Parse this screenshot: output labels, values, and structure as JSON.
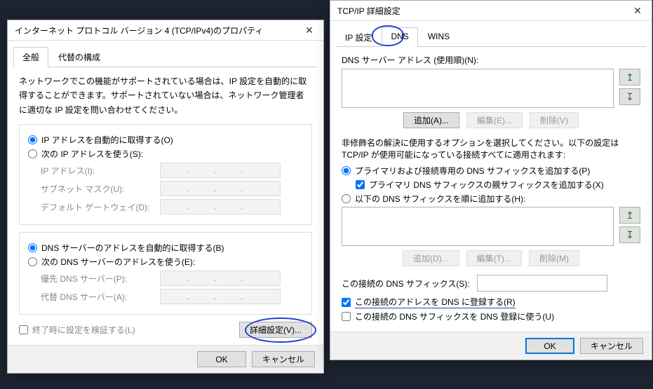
{
  "ipv4": {
    "title": "インターネット プロトコル バージョン 4 (TCP/IPv4)のプロパティ",
    "tabs": {
      "general": "全般",
      "alt": "代替の構成"
    },
    "description": "ネットワークでこの機能がサポートされている場合は、IP 設定を自動的に取得することができます。サポートされていない場合は、ネットワーク管理者に適切な IP 設定を問い合わせてください。",
    "ip_auto": "IP アドレスを自動的に取得する(O)",
    "ip_manual": "次の IP アドレスを使う(S):",
    "ip_label": "IP アドレス(I):",
    "mask_label": "サブネット マスク(U):",
    "gw_label": "デフォルト ゲートウェイ(D):",
    "dns_auto": "DNS サーバーのアドレスを自動的に取得する(B)",
    "dns_manual": "次の DNS サーバーのアドレスを使う(E):",
    "dns_pref": "優先 DNS サーバー(P):",
    "dns_alt": "代替 DNS サーバー(A):",
    "validate": "終了時に設定を検証する(L)",
    "advanced": "詳細設定(V)...",
    "ok": "OK",
    "cancel": "キャンセル",
    "dots": ".    .    ."
  },
  "adv": {
    "title": "TCP/IP 詳細設定",
    "tabs": {
      "ip": "IP 設定",
      "dns": "DNS",
      "wins": "WINS"
    },
    "server_list": "DNS サーバー アドレス (使用順)(N):",
    "add": "追加(A)...",
    "edit": "編集(E)...",
    "delete": "削除(V)",
    "suffix_desc": "非修飾名の解決に使用するオプションを選択してください。以下の設定は TCP/IP が使用可能になっている接続すべてに適用されます:",
    "suffix_primary": "プライマリおよび接続専用の DNS サフィックスを追加する(P)",
    "suffix_parent": "プライマリ DNS サフィックスの親サフィックスを追加する(X)",
    "suffix_order": "以下の DNS サフィックスを順に追加する(H):",
    "add2": "追加(D)...",
    "edit2": "編集(T)...",
    "delete2": "削除(M)",
    "conn_suffix": "この接続の DNS サフィックス(S):",
    "register": "この接続のアドレスを DNS に登録する(R)",
    "use_suffix_reg": "この接続の DNS サフィックスを DNS 登録に使う(U)",
    "ok": "OK",
    "cancel": "キャンセル"
  }
}
